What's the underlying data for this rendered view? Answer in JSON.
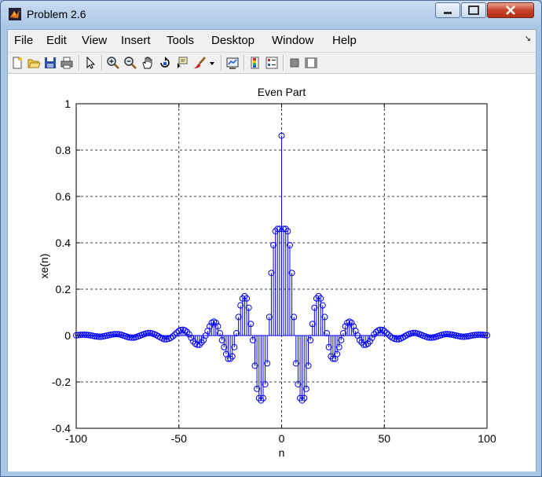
{
  "window": {
    "title": "Problem 2.6"
  },
  "menu": [
    "File",
    "Edit",
    "View",
    "Insert",
    "Tools",
    "Desktop",
    "Window",
    "Help"
  ],
  "toolbar": {
    "icons": [
      "new-figure-icon",
      "open-file-icon",
      "save-icon",
      "print-icon",
      "pointer-icon",
      "zoom-in-icon",
      "zoom-out-icon",
      "pan-icon",
      "rotate-3d-icon",
      "data-cursor-icon",
      "brush-icon",
      "brush-dropdown-icon",
      "link-plot-icon",
      "colorbar-icon",
      "legend-icon",
      "hide-plot-tools-icon",
      "show-plot-tools-icon"
    ]
  },
  "colors": {
    "series": "#0000ff",
    "axis": "#000000",
    "background": "#ffffff"
  },
  "chart_data": {
    "type": "stem",
    "title": "Even Part",
    "xlabel": "n",
    "ylabel": "xe(n)",
    "xlim": [
      -100,
      100
    ],
    "ylim": [
      -0.4,
      1
    ],
    "xticks": [
      "-100",
      "-50",
      "0",
      "50",
      "100"
    ],
    "yticks": [
      "-0.4",
      "-0.2",
      "0",
      "0.2",
      "0.4",
      "0.6",
      "0.8",
      "1"
    ],
    "grid": "on",
    "series": [
      {
        "n_range": [
          -100,
          100
        ],
        "description_peak": [
          0,
          0.8624
        ],
        "x": [
          0,
          1,
          2,
          3,
          4,
          5,
          6,
          7,
          8,
          9,
          10,
          11,
          12,
          13,
          14,
          15,
          16,
          17,
          18,
          19,
          20,
          21,
          22,
          23,
          24,
          25,
          26,
          27,
          28,
          29,
          30,
          31,
          32,
          33,
          34,
          35,
          36,
          37,
          38,
          39,
          40,
          41,
          42,
          43,
          44,
          45,
          46,
          47,
          48,
          49,
          50,
          51,
          52,
          53,
          54,
          55,
          56,
          57,
          58,
          59,
          60,
          61,
          62,
          63,
          64,
          65,
          66,
          67,
          68,
          69,
          70,
          71,
          72,
          73,
          74,
          75,
          76,
          77,
          78,
          79,
          80,
          81,
          82,
          83,
          84,
          85,
          86,
          87,
          88,
          89,
          90,
          91,
          92,
          93,
          94,
          95,
          96,
          97,
          98,
          99,
          100
        ],
        "y": [
          0.862,
          0.46,
          0.46,
          0.45,
          0.39,
          0.27,
          0.08,
          -0.12,
          -0.21,
          -0.27,
          -0.28,
          -0.27,
          -0.23,
          -0.13,
          -0.02,
          0.05,
          0.12,
          0.16,
          0.17,
          0.16,
          0.13,
          0.08,
          0.01,
          -0.05,
          -0.09,
          -0.1,
          -0.1,
          -0.08,
          -0.05,
          -0.02,
          0.01,
          0.04,
          0.055,
          0.06,
          0.055,
          0.04,
          0.02,
          0.0,
          -0.02,
          -0.03,
          -0.04,
          -0.04,
          -0.035,
          -0.025,
          -0.01,
          0.005,
          0.015,
          0.022,
          0.025,
          0.024,
          0.02,
          0.012,
          0.004,
          -0.004,
          -0.01,
          -0.014,
          -0.016,
          -0.016,
          -0.013,
          -0.008,
          -0.003,
          0.002,
          0.006,
          0.009,
          0.011,
          0.011,
          0.009,
          0.006,
          0.003,
          -0.001,
          -0.004,
          -0.007,
          -0.009,
          -0.009,
          -0.008,
          -0.006,
          -0.003,
          0.0,
          0.003,
          0.005,
          0.006,
          0.006,
          0.005,
          0.004,
          0.002,
          0.0,
          -0.002,
          -0.004,
          -0.005,
          -0.005,
          -0.004,
          -0.003,
          -0.001,
          0.001,
          0.002,
          0.003,
          0.004,
          0.004,
          0.003,
          0.002,
          0.001
        ]
      }
    ]
  }
}
